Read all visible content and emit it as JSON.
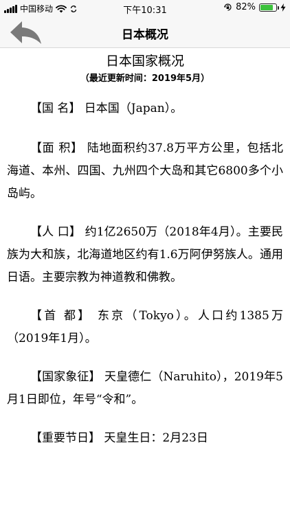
{
  "status_bar": {
    "carrier": "中国移动",
    "time": "下午10:31",
    "battery_percent_label": "82%",
    "battery_level": 0.82,
    "icons": [
      "signal-bars-icon",
      "wifi-icon",
      "sync-icon",
      "orientation-lock-icon",
      "battery-icon",
      "charging-icon"
    ]
  },
  "nav": {
    "title": "日本概况",
    "back_icon": "back-arrow-icon"
  },
  "document": {
    "title": "日本国家概况",
    "subtitle": "（最近更新时间：2019年5月）",
    "paragraphs": [
      "【国 名】 日本国（Japan）。",
      "【面 积】 陆地面积约37.8万平方公里，包括北海道、本州、四国、九州四个大岛和其它6800多个小岛屿。",
      "【人 口】 约1亿2650万（2018年4月）。主要民族为大和族，北海道地区约有1.6万阿伊努族人。通用日语。主要宗教为神道教和佛教。",
      "【首 都】 东京（Tokyo）。人口约1385万（2019年1月）。",
      "【国家象征】 天皇德仁（Naruhito），2019年5月1日即位，年号“令和”。",
      "【重要节日】 天皇生日：2月23日"
    ]
  },
  "colors": {
    "bar_background": "#f7f7f7",
    "back_arrow": "#7a7a7a",
    "battery_fill": "#3cc23c"
  }
}
